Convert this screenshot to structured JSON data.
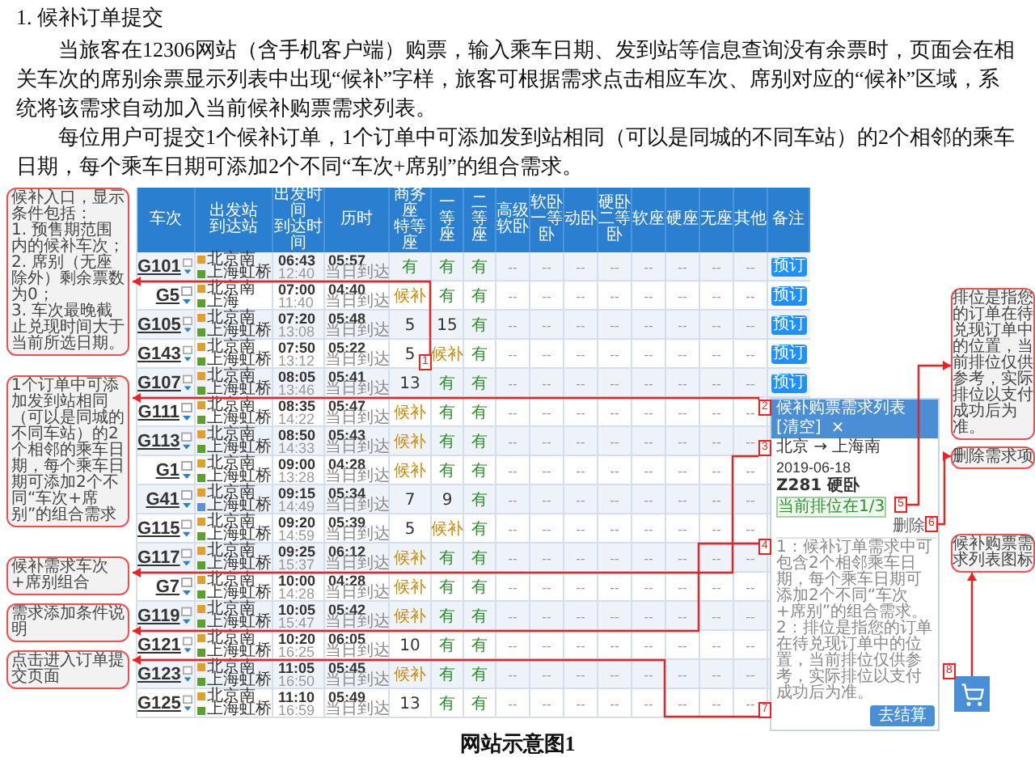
{
  "heading": "1. 候补订单提交",
  "paragraphs": [
    "当旅客在12306网站（含手机客户端）购票，输入乘车日期、发到站等信息查询没有余票时，页面会在相关车次的席别余票显示列表中出现“候补”字样，旅客可根据需求点击相应车次、席别对应的“候补”区域，系统将该需求自动加入当前候补购票需求列表。",
    "每位用户可提交1个候补订单，1个订单中可添加发到站相同（可以是同城的不同车站）的2个相邻的乘车日期，每个乘车日期可添加2个不同“车次+席别”的组合需求。"
  ],
  "figure": {
    "callouts_left": [
      {
        "lines": [
          "候补入口，显示条件包括：",
          "1. 预售期范围内的候补车次；",
          "2. 席别（无座除外）剩余票数为0；",
          "3. 车次最晚截止兑现时间大于当前所选日期。"
        ]
      },
      {
        "lines": [
          "1个订单中可添加发到站相同（可以是同城的不同车站）的2个相邻的乘车日期，每个乘车日期可添加2个不同“车次+席别”的组合需求"
        ]
      },
      {
        "lines": [
          "候补需求车次+席别组合"
        ]
      },
      {
        "lines": [
          "需求添加条件说明"
        ]
      },
      {
        "lines": [
          "点击进入订单提交页面"
        ]
      }
    ],
    "table": {
      "columns": [
        {
          "lines": [
            "车次"
          ]
        },
        {
          "lines": [
            "出发站",
            "到达站"
          ]
        },
        {
          "lines": [
            "出发时间",
            "到达时间"
          ]
        },
        {
          "lines": [
            "历时"
          ]
        },
        {
          "lines": [
            "商务座",
            "特等座"
          ]
        },
        {
          "lines": [
            "一等座"
          ]
        },
        {
          "lines": [
            "二等座"
          ]
        },
        {
          "lines": [
            "高级",
            "软卧"
          ]
        },
        {
          "lines": [
            "软卧",
            "一等卧"
          ]
        },
        {
          "lines": [
            "动卧"
          ]
        },
        {
          "lines": [
            "硬卧",
            "二等卧"
          ]
        },
        {
          "lines": [
            "软座"
          ]
        },
        {
          "lines": [
            "硬座"
          ]
        },
        {
          "lines": [
            "无座"
          ]
        },
        {
          "lines": [
            "其他"
          ]
        },
        {
          "lines": [
            "备注"
          ]
        }
      ],
      "rows": [
        {
          "train": "G101",
          "from": {
            "name": "北京南",
            "color": "#e0a030"
          },
          "to": {
            "name": "上海虹桥",
            "color": "#5aa02c"
          },
          "depart": "06:43",
          "arrive": "12:40",
          "duration": "05:57",
          "arrival_day": "当日到达",
          "seats": [
            {
              "text": "有",
              "kind": "available"
            },
            {
              "text": "有",
              "kind": "available"
            },
            {
              "text": "有",
              "kind": "available"
            }
          ],
          "other_seats": [
            "--",
            "--",
            "--",
            "--",
            "--",
            "--",
            "--",
            "--"
          ],
          "button": "预订"
        },
        {
          "train": "G5",
          "from": {
            "name": "北京南",
            "color": "#e0a030"
          },
          "to": {
            "name": "上海",
            "color": "#5aa02c"
          },
          "depart": "07:00",
          "arrive": "11:40",
          "duration": "04:40",
          "arrival_day": "当日到达",
          "seats": [
            {
              "text": "候补",
              "kind": "waitlist"
            },
            {
              "text": "有",
              "kind": "available"
            },
            {
              "text": "有",
              "kind": "available"
            }
          ],
          "other_seats": [
            "--",
            "--",
            "--",
            "--",
            "--",
            "--",
            "--",
            "--"
          ],
          "button": "预订"
        },
        {
          "train": "G105",
          "from": {
            "name": "北京南",
            "color": "#e0a030"
          },
          "to": {
            "name": "上海虹桥",
            "color": "#5aa02c"
          },
          "depart": "07:20",
          "arrive": "13:08",
          "duration": "05:48",
          "arrival_day": "当日到达",
          "seats": [
            {
              "text": "5",
              "kind": "count"
            },
            {
              "text": "15",
              "kind": "count"
            },
            {
              "text": "有",
              "kind": "available"
            }
          ],
          "other_seats": [
            "--",
            "--",
            "--",
            "--",
            "--",
            "--",
            "--",
            "--"
          ],
          "button": "预订"
        },
        {
          "train": "G143",
          "from": {
            "name": "北京南",
            "color": "#e0a030"
          },
          "to": {
            "name": "上海虹桥",
            "color": "#5aa02c"
          },
          "depart": "07:50",
          "arrive": "13:12",
          "duration": "05:22",
          "arrival_day": "当日到达",
          "seats": [
            {
              "text": "5",
              "kind": "count"
            },
            {
              "text": "候补",
              "kind": "waitlist"
            },
            {
              "text": "有",
              "kind": "available"
            }
          ],
          "other_seats": [
            "--",
            "--",
            "--",
            "--",
            "--",
            "--",
            "--",
            "--"
          ],
          "button": "预订"
        },
        {
          "train": "G107",
          "from": {
            "name": "北京南",
            "color": "#e0a030"
          },
          "to": {
            "name": "上海虹桥",
            "color": "#5aa02c"
          },
          "depart": "08:05",
          "arrive": "13:46",
          "duration": "05:41",
          "arrival_day": "当日到达",
          "seats": [
            {
              "text": "13",
              "kind": "count"
            },
            {
              "text": "有",
              "kind": "available"
            },
            {
              "text": "有",
              "kind": "available"
            }
          ],
          "other_seats": [
            "--",
            "--",
            "--",
            "--",
            "--",
            "--",
            "--",
            "--"
          ],
          "button": "预订"
        },
        {
          "train": "G111",
          "from": {
            "name": "北京南",
            "color": "#e0a030"
          },
          "to": {
            "name": "上海虹桥",
            "color": "#5aa02c"
          },
          "depart": "08:35",
          "arrive": "14:22",
          "duration": "05:47",
          "arrival_day": "当日到达",
          "seats": [
            {
              "text": "候补",
              "kind": "waitlist"
            },
            {
              "text": "有",
              "kind": "available"
            },
            {
              "text": "有",
              "kind": "available"
            }
          ],
          "other_seats": [
            "--",
            "--",
            "--",
            "--",
            "--",
            "--",
            "--",
            "--"
          ]
        },
        {
          "train": "G113",
          "from": {
            "name": "北京南",
            "color": "#e0a030"
          },
          "to": {
            "name": "上海虹桥",
            "color": "#5aa02c"
          },
          "depart": "08:50",
          "arrive": "14:33",
          "duration": "05:43",
          "arrival_day": "当日到达",
          "seats": [
            {
              "text": "候补",
              "kind": "waitlist"
            },
            {
              "text": "有",
              "kind": "available"
            },
            {
              "text": "有",
              "kind": "available"
            }
          ],
          "other_seats": [
            "--",
            "--",
            "--",
            "--",
            "--",
            "--",
            "--",
            "--"
          ]
        },
        {
          "train": "G1",
          "from": {
            "name": "北京南",
            "color": "#e0a030"
          },
          "to": {
            "name": "上海虹桥",
            "color": "#5aa02c"
          },
          "depart": "09:00",
          "arrive": "13:28",
          "duration": "04:28",
          "arrival_day": "当日到达",
          "seats": [
            {
              "text": "候补",
              "kind": "waitlist"
            },
            {
              "text": "有",
              "kind": "available"
            },
            {
              "text": "有",
              "kind": "available"
            }
          ],
          "other_seats": [
            "--",
            "--",
            "--",
            "--",
            "--",
            "--",
            "--",
            "--"
          ]
        },
        {
          "train": "G41",
          "from": {
            "name": "北京南",
            "color": "#e0a030"
          },
          "to": {
            "name": "上海虹桥",
            "color": "#5b8fd6"
          },
          "depart": "09:15",
          "arrive": "14:49",
          "duration": "05:34",
          "arrival_day": "当日到达",
          "seats": [
            {
              "text": "7",
              "kind": "count"
            },
            {
              "text": "9",
              "kind": "count"
            },
            {
              "text": "有",
              "kind": "available"
            }
          ],
          "other_seats": [
            "--",
            "--",
            "--",
            "--",
            "--",
            "--",
            "--",
            "--"
          ]
        },
        {
          "train": "G115",
          "from": {
            "name": "北京南",
            "color": "#e0a030"
          },
          "to": {
            "name": "上海虹桥",
            "color": "#5aa02c"
          },
          "depart": "09:20",
          "arrive": "14:59",
          "duration": "05:39",
          "arrival_day": "当日到达",
          "seats": [
            {
              "text": "5",
              "kind": "count"
            },
            {
              "text": "候补",
              "kind": "waitlist"
            },
            {
              "text": "有",
              "kind": "available"
            }
          ],
          "other_seats": [
            "--",
            "--",
            "--",
            "--",
            "--",
            "--",
            "--",
            "--"
          ]
        },
        {
          "train": "G117",
          "from": {
            "name": "北京南",
            "color": "#e0a030"
          },
          "to": {
            "name": "上海虹桥",
            "color": "#5aa02c"
          },
          "depart": "09:25",
          "arrive": "15:37",
          "duration": "06:12",
          "arrival_day": "当日到达",
          "seats": [
            {
              "text": "候补",
              "kind": "waitlist"
            },
            {
              "text": "有",
              "kind": "available"
            },
            {
              "text": "有",
              "kind": "available"
            }
          ],
          "other_seats": [
            "--",
            "--",
            "--",
            "--",
            "--",
            "--",
            "--",
            "--"
          ]
        },
        {
          "train": "G7",
          "from": {
            "name": "北京南",
            "color": "#e0a030"
          },
          "to": {
            "name": "上海虹桥",
            "color": "#5aa02c"
          },
          "depart": "10:00",
          "arrive": "14:28",
          "duration": "04:28",
          "arrival_day": "当日到达",
          "seats": [
            {
              "text": "候补",
              "kind": "waitlist"
            },
            {
              "text": "有",
              "kind": "available"
            },
            {
              "text": "有",
              "kind": "available"
            }
          ],
          "other_seats": [
            "--",
            "--",
            "--",
            "--",
            "--",
            "--",
            "--",
            "--"
          ]
        },
        {
          "train": "G119",
          "from": {
            "name": "北京南",
            "color": "#e0a030"
          },
          "to": {
            "name": "上海虹桥",
            "color": "#5aa02c"
          },
          "depart": "10:05",
          "arrive": "15:47",
          "duration": "05:42",
          "arrival_day": "当日到达",
          "seats": [
            {
              "text": "候补",
              "kind": "waitlist"
            },
            {
              "text": "有",
              "kind": "available"
            },
            {
              "text": "有",
              "kind": "available"
            }
          ],
          "other_seats": [
            "--",
            "--",
            "--",
            "--",
            "--",
            "--",
            "--",
            "--"
          ]
        },
        {
          "train": "G121",
          "from": {
            "name": "北京南",
            "color": "#e0a030"
          },
          "to": {
            "name": "上海虹桥",
            "color": "#5aa02c"
          },
          "depart": "10:20",
          "arrive": "16:25",
          "duration": "06:05",
          "arrival_day": "当日到达",
          "seats": [
            {
              "text": "10",
              "kind": "count"
            },
            {
              "text": "有",
              "kind": "available"
            },
            {
              "text": "有",
              "kind": "available"
            }
          ],
          "other_seats": [
            "--",
            "--",
            "--",
            "--",
            "--",
            "--",
            "--",
            "--"
          ]
        },
        {
          "train": "G123",
          "from": {
            "name": "北京南",
            "color": "#e0a030"
          },
          "to": {
            "name": "上海虹桥",
            "color": "#5aa02c"
          },
          "depart": "11:05",
          "arrive": "16:50",
          "duration": "05:45",
          "arrival_day": "当日到达",
          "seats": [
            {
              "text": "候补",
              "kind": "waitlist"
            },
            {
              "text": "有",
              "kind": "available"
            },
            {
              "text": "有",
              "kind": "available"
            }
          ],
          "other_seats": [
            "--",
            "--",
            "--",
            "--",
            "--",
            "--",
            "--",
            "--"
          ]
        },
        {
          "train": "G125",
          "from": {
            "name": "北京南",
            "color": "#e0a030"
          },
          "to": {
            "name": "上海虹桥",
            "color": "#5aa02c"
          },
          "depart": "11:10",
          "arrive": "16:59",
          "duration": "05:49",
          "arrival_day": "当日到达",
          "seats": [
            {
              "text": "13",
              "kind": "count"
            },
            {
              "text": "有",
              "kind": "available"
            },
            {
              "text": "有",
              "kind": "available"
            }
          ],
          "other_seats": [
            "--",
            "--",
            "--",
            "--",
            "--",
            "--",
            "--",
            "--"
          ]
        }
      ]
    },
    "popup": {
      "title": "候补购票需求列表",
      "clear": "[清空]",
      "close": "×",
      "route": "北京 → 上海南",
      "date": "2019-06-18",
      "train": "Z281 硬卧",
      "rank": "当前排位在1/3",
      "delete": "删除",
      "notes": [
        "1：候补订单需求中可包含2个相邻乘车日期，每个乘车日期可添加2个不同“车次+席别”的组合需求。",
        "2：排位是指您的订单在待兑现订单中的位置，当前排位仅供参考，实际排位以支付成功后为准。"
      ],
      "button": "去结算"
    },
    "callouts_right": [
      {
        "lines": [
          "排位是指您的订单在待兑现订单中的位置，当前排位仅供参考，实际排位以支付成功后为准。"
        ]
      },
      {
        "lines": [
          "删除需求项"
        ]
      },
      {
        "lines": [
          "候补购票需求列表图标"
        ]
      }
    ],
    "markers": [
      "1",
      "2",
      "3",
      "4",
      "5",
      "6",
      "7",
      "8"
    ],
    "caption": "网站示意图1"
  }
}
